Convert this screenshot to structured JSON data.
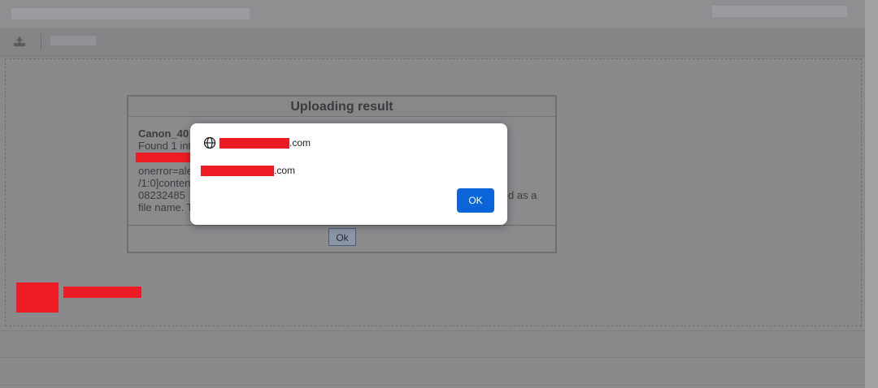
{
  "upload_dialog": {
    "title": "Uploading result",
    "file_name_prefix": "Canon_40",
    "found_prefix": "Found 1 inte",
    "line_onerror": "onerror=ale",
    "line_content": "/1:0]content",
    "line_number": "08232485",
    "line_suffix_right": "d as a",
    "line_file_name": "file name. T",
    "ok_label": "Ok"
  },
  "alert": {
    "origin_suffix": ".com",
    "message_suffix": ".com",
    "ok_label": "OK",
    "accent_color": "#0b65d8",
    "icon": "globe-icon"
  },
  "toolbar": {
    "icon": "upload-icon"
  },
  "redaction_color": "#ed1c24"
}
